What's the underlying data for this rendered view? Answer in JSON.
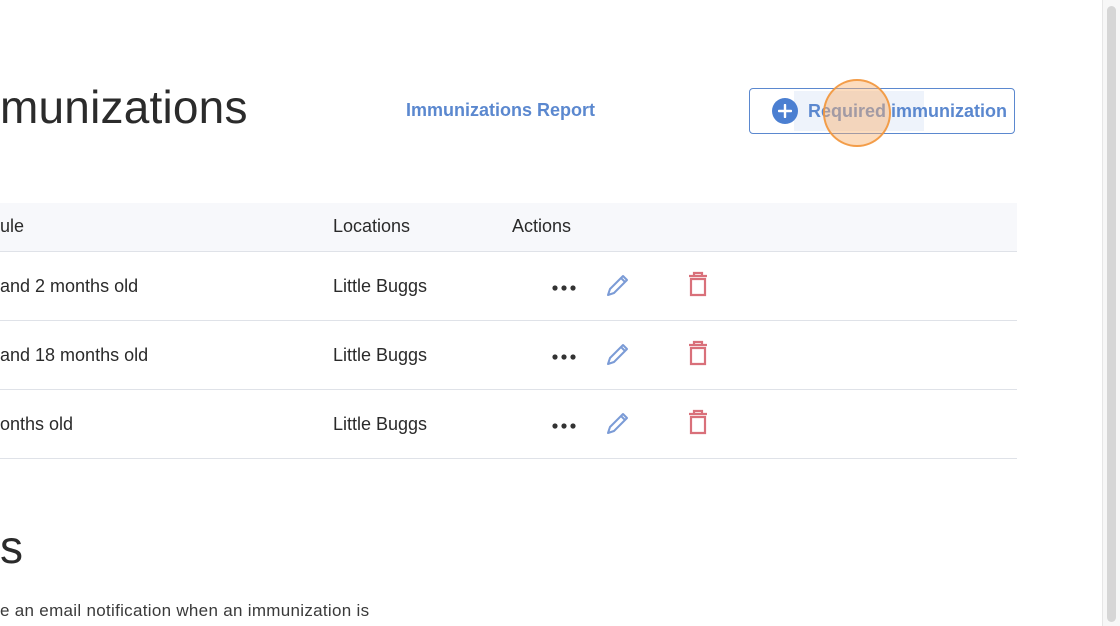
{
  "page": {
    "title": "munizations",
    "report_link": "Immunizations Report",
    "required_button": "Required immunization"
  },
  "table": {
    "headers": {
      "schedule": "ule",
      "locations": "Locations",
      "actions": "Actions"
    },
    "rows": [
      {
        "schedule": "and 2 months old",
        "location": "Little Buggs"
      },
      {
        "schedule": "and 18 months old",
        "location": "Little Buggs"
      },
      {
        "schedule": "onths old",
        "location": "Little Buggs"
      }
    ]
  },
  "notifications": {
    "title": "s",
    "description": "e an email notification when an immunization is"
  },
  "icons": {
    "add": "plus-circle-icon",
    "more": "more-horizontal-icon",
    "edit": "pencil-icon",
    "delete": "trash-icon"
  },
  "colors": {
    "accent": "#5b88cf",
    "accent_fill": "#4b7fd1",
    "edit_icon": "#7b9bd6",
    "delete_icon": "#d9707a",
    "header_bg": "#f7f8fb",
    "click_indicator": "#f8b26e"
  }
}
